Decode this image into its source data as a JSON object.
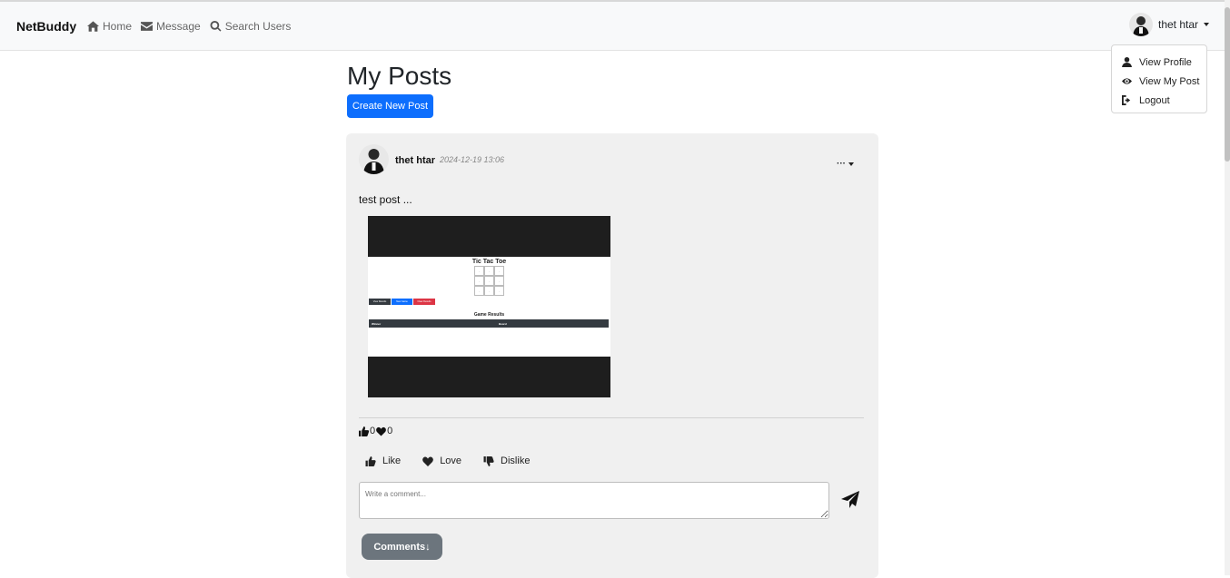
{
  "navbar": {
    "brand": "NetBuddy",
    "links": [
      {
        "icon": "home-icon",
        "label": "Home"
      },
      {
        "icon": "envelope-icon",
        "label": "Message"
      },
      {
        "icon": "search-icon",
        "label": "Search Users"
      }
    ],
    "user_name": "thet htar"
  },
  "user_menu": {
    "items": [
      {
        "icon": "user-icon",
        "label": "View Profile"
      },
      {
        "icon": "eye-icon",
        "label": "View My Post"
      },
      {
        "icon": "logout-icon",
        "label": "Logout"
      }
    ]
  },
  "page": {
    "title": "My Posts",
    "create_button": "Create New Post"
  },
  "post": {
    "author": "thet htar",
    "timestamp": "2024-12-19 13:06",
    "more_label": "···",
    "text": "test post ...",
    "image": {
      "title": "Tic Tac Toe",
      "buttons": [
        "View Results",
        "New Game",
        "Clear Results"
      ],
      "results_title": "Game Results",
      "table_headers": [
        "Winner",
        "Board"
      ]
    },
    "like_count": "0",
    "love_count": "0",
    "reactions": {
      "like": "Like",
      "love": "Love",
      "dislike": "Dislike"
    },
    "comment_placeholder": "Write a comment...",
    "comments_button": "Comments↓"
  }
}
